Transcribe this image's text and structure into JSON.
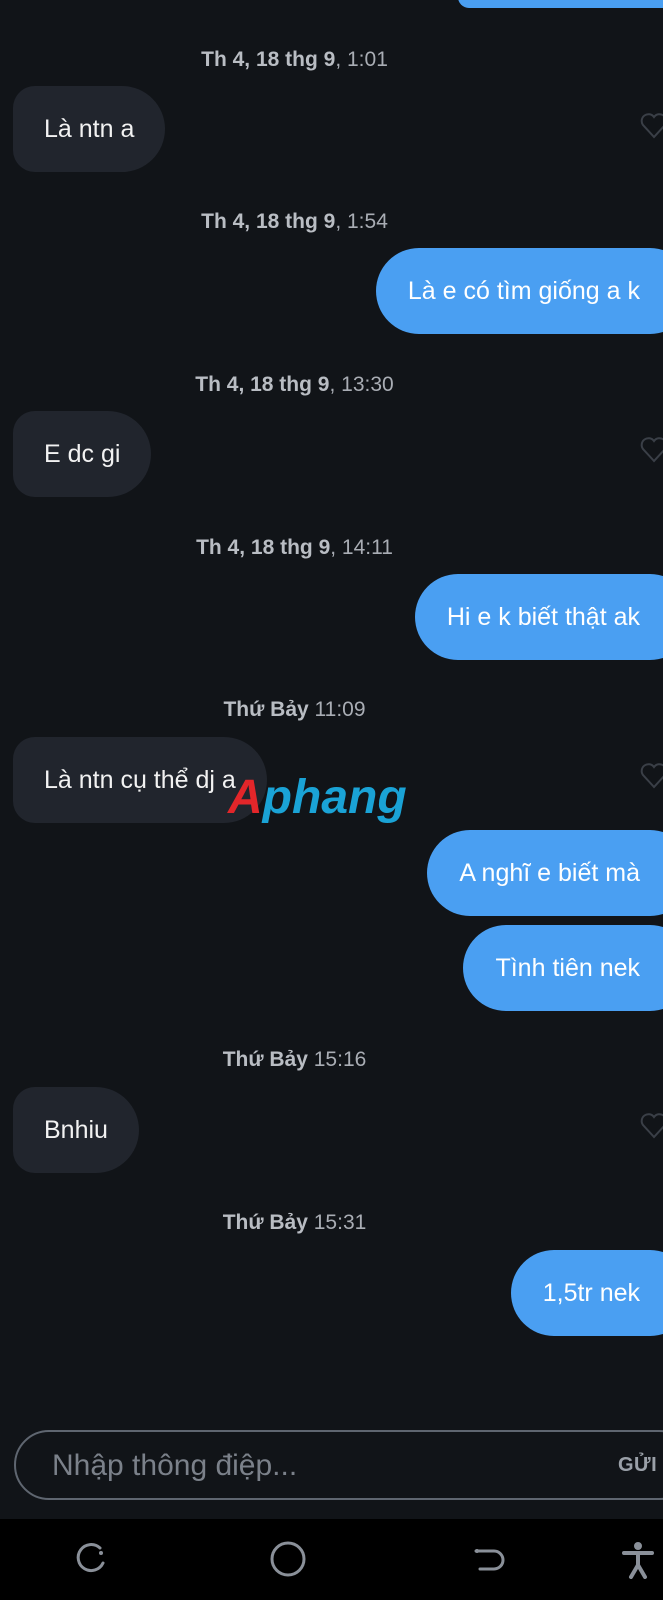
{
  "chat": {
    "messages": [
      {
        "timestamp": {
          "day": "Th 4, 18 thg 9",
          "time": ", 1:01"
        },
        "direction": "incoming",
        "text": "Là ntn a"
      },
      {
        "timestamp": {
          "day": "Th 4, 18 thg 9",
          "time": ", 1:54"
        },
        "direction": "outgoing",
        "text": "Là e có tìm giống a k"
      },
      {
        "timestamp": {
          "day": "Th 4, 18 thg 9",
          "time": ", 13:30"
        },
        "direction": "incoming",
        "text": "E dc gi"
      },
      {
        "timestamp": {
          "day": "Th 4, 18 thg 9",
          "time": ", 14:11"
        },
        "direction": "outgoing",
        "text": "Hi e k biết thật ak"
      },
      {
        "timestamp": {
          "day": "Thứ Bảy",
          "time": " 11:09"
        },
        "direction": "incoming",
        "text": "Là ntn cụ thể dj a"
      },
      {
        "direction": "outgoing",
        "text": "A nghĩ e biết mà"
      },
      {
        "direction": "outgoing",
        "text": "Tình tiên nek"
      },
      {
        "timestamp": {
          "day": "Thứ Bảy",
          "time": " 15:16"
        },
        "direction": "incoming",
        "text": "Bnhiu"
      },
      {
        "timestamp": {
          "day": "Thứ Bảy",
          "time": " 15:31"
        },
        "direction": "outgoing",
        "text": "1,5tr nek"
      }
    ]
  },
  "watermark": {
    "first": "A",
    "rest": "phang"
  },
  "composer": {
    "placeholder": "Nhập thông điệp...",
    "send_label": "GỬI"
  },
  "colors": {
    "background": "#111418",
    "incoming_bubble": "#21252d",
    "outgoing_bubble": "#4a9ff2"
  },
  "icons": {
    "like": "heart-outline-icon",
    "nav_recent": "recent-apps-icon",
    "nav_home": "home-icon",
    "nav_back": "back-icon",
    "nav_accessibility": "accessibility-icon"
  }
}
